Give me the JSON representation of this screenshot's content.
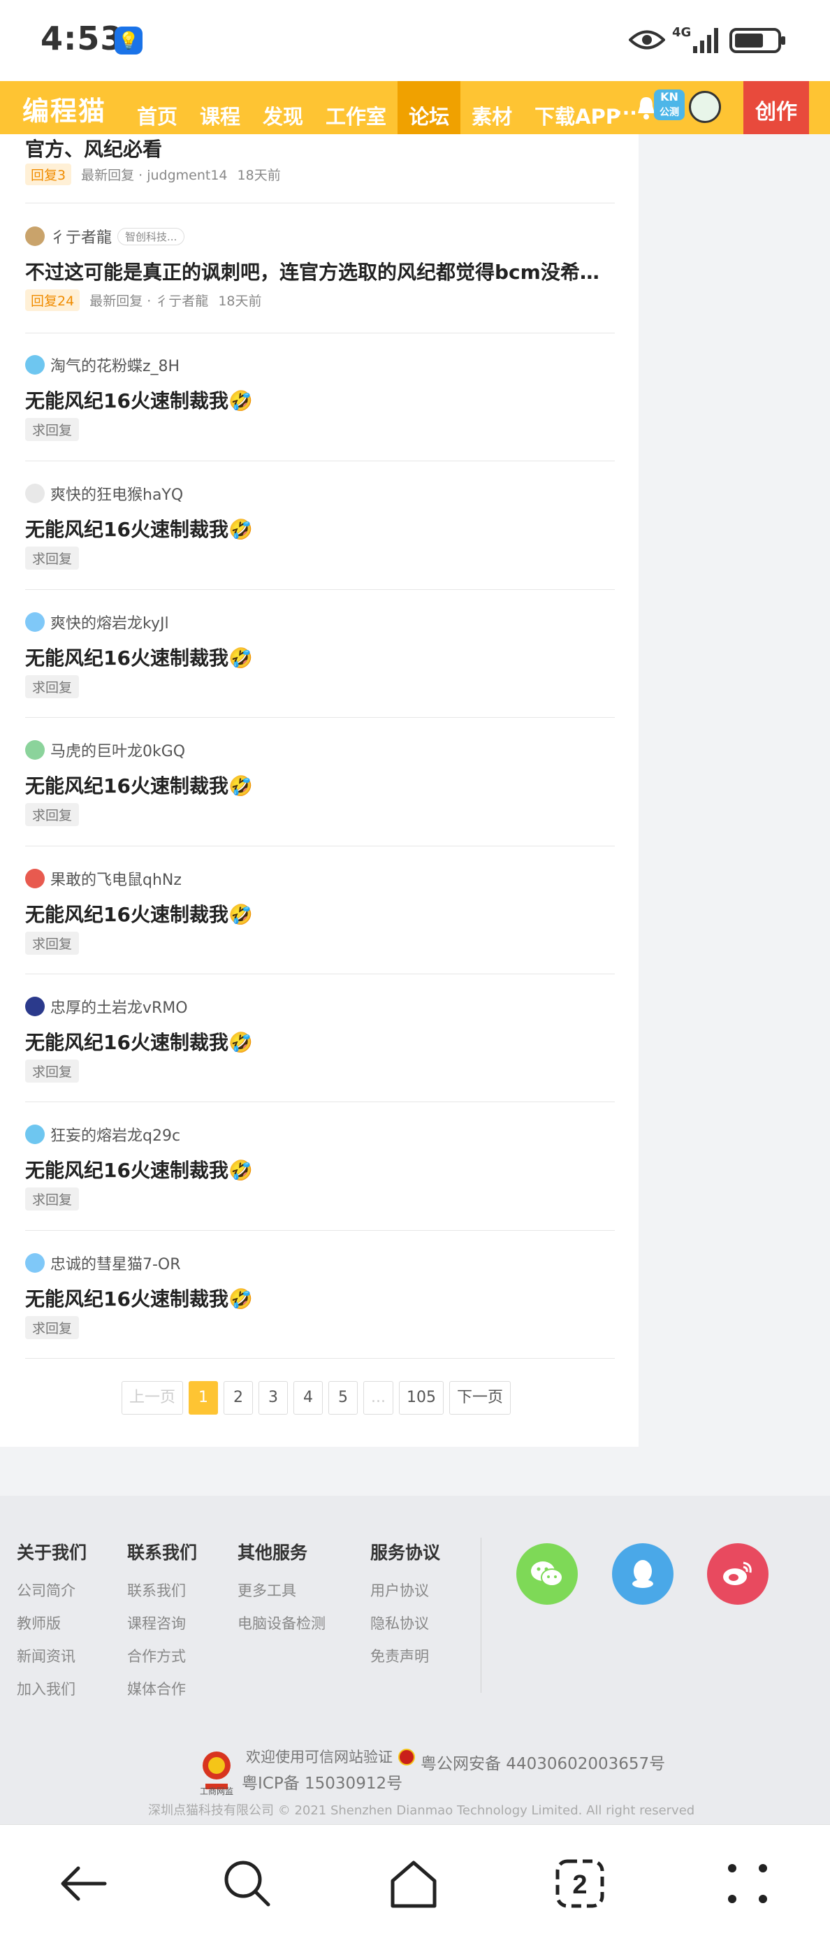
{
  "status_bar": {
    "time": "4:53",
    "network": "4G"
  },
  "nav": {
    "logo": "编程猫",
    "items": [
      "首页",
      "课程",
      "发现",
      "工作室",
      "论坛",
      "素材",
      "下载APP"
    ],
    "active_index": 4,
    "more": "...",
    "kn_badge": "KN",
    "kn_sub": "公测",
    "create": "创作"
  },
  "first_post": {
    "title": "官方、风纪必看",
    "reply": "回复3",
    "latest": "最新回复 · judgment14",
    "time": "18天前"
  },
  "posts": [
    {
      "author": "彳亍者龍",
      "tag": "智创科技...",
      "title": "不过这可能是真正的讽刺吧，连官方选取的风纪都觉得bcm没希望...",
      "reply": "回复24",
      "latest": "最新回复 · 彳亍者龍",
      "time": "18天前",
      "avatar_color": "#c9a36b"
    },
    {
      "author": "淘气的花粉蝶z_8H",
      "title": "无能风纪16火速制裁我🤣",
      "reply": "求回复",
      "avatar_color": "#6ec6f0"
    },
    {
      "author": "爽快的狂电猴haYQ",
      "title": "无能风纪16火速制裁我🤣",
      "reply": "求回复",
      "avatar_color": "#e0e0e0"
    },
    {
      "author": "爽快的熔岩龙kyJl",
      "title": "无能风纪16火速制裁我🤣",
      "reply": "求回复",
      "avatar_color": "#7fc8f8"
    },
    {
      "author": "马虎的巨叶龙0kGQ",
      "title": "无能风纪16火速制裁我🤣",
      "reply": "求回复",
      "avatar_color": "#8bd39b"
    },
    {
      "author": "果敢的飞电鼠qhNz",
      "title": "无能风纪16火速制裁我🤣",
      "reply": "求回复",
      "avatar_color": "#e85a4f"
    },
    {
      "author": "忠厚的土岩龙vRMO",
      "title": "无能风纪16火速制裁我🤣",
      "reply": "求回复",
      "avatar_color": "#2b3a8c"
    },
    {
      "author": "狂妄的熔岩龙q29c",
      "title": "无能风纪16火速制裁我🤣",
      "reply": "求回复",
      "avatar_color": "#6ec6f0"
    },
    {
      "author": "忠诚的彗星猫7-OR",
      "title": "无能风纪16火速制裁我🤣",
      "reply": "求回复",
      "avatar_color": "#7fc8f8"
    }
  ],
  "pagination": {
    "prev": "上一页",
    "pages": [
      "1",
      "2",
      "3",
      "4",
      "5",
      "...",
      "105"
    ],
    "current": "1",
    "next": "下一页"
  },
  "footer": {
    "columns": [
      {
        "title": "关于我们",
        "links": [
          "公司简介",
          "教师版",
          "新闻资讯",
          "加入我们"
        ]
      },
      {
        "title": "联系我们",
        "links": [
          "联系我们",
          "课程咨询",
          "合作方式",
          "媒体合作"
        ]
      },
      {
        "title": "其他服务",
        "links": [
          "更多工具",
          "电脑设备检测"
        ]
      },
      {
        "title": "服务协议",
        "links": [
          "用户协议",
          "隐私协议",
          "免责声明"
        ]
      }
    ],
    "social": {
      "wechat_color": "#7ed957",
      "qq_color": "#4aa8e8",
      "weibo_color": "#e84a5f"
    },
    "trust_line1": "欢迎使用可信网站验证",
    "icp": "粤ICP备 15030912号",
    "police": "粤公网安备 44030602003657号",
    "badge_caption": "工商网监",
    "copyright": "深圳点猫科技有限公司   © 2021 Shenzhen Dianmao Technology Limited. All right reserved"
  }
}
